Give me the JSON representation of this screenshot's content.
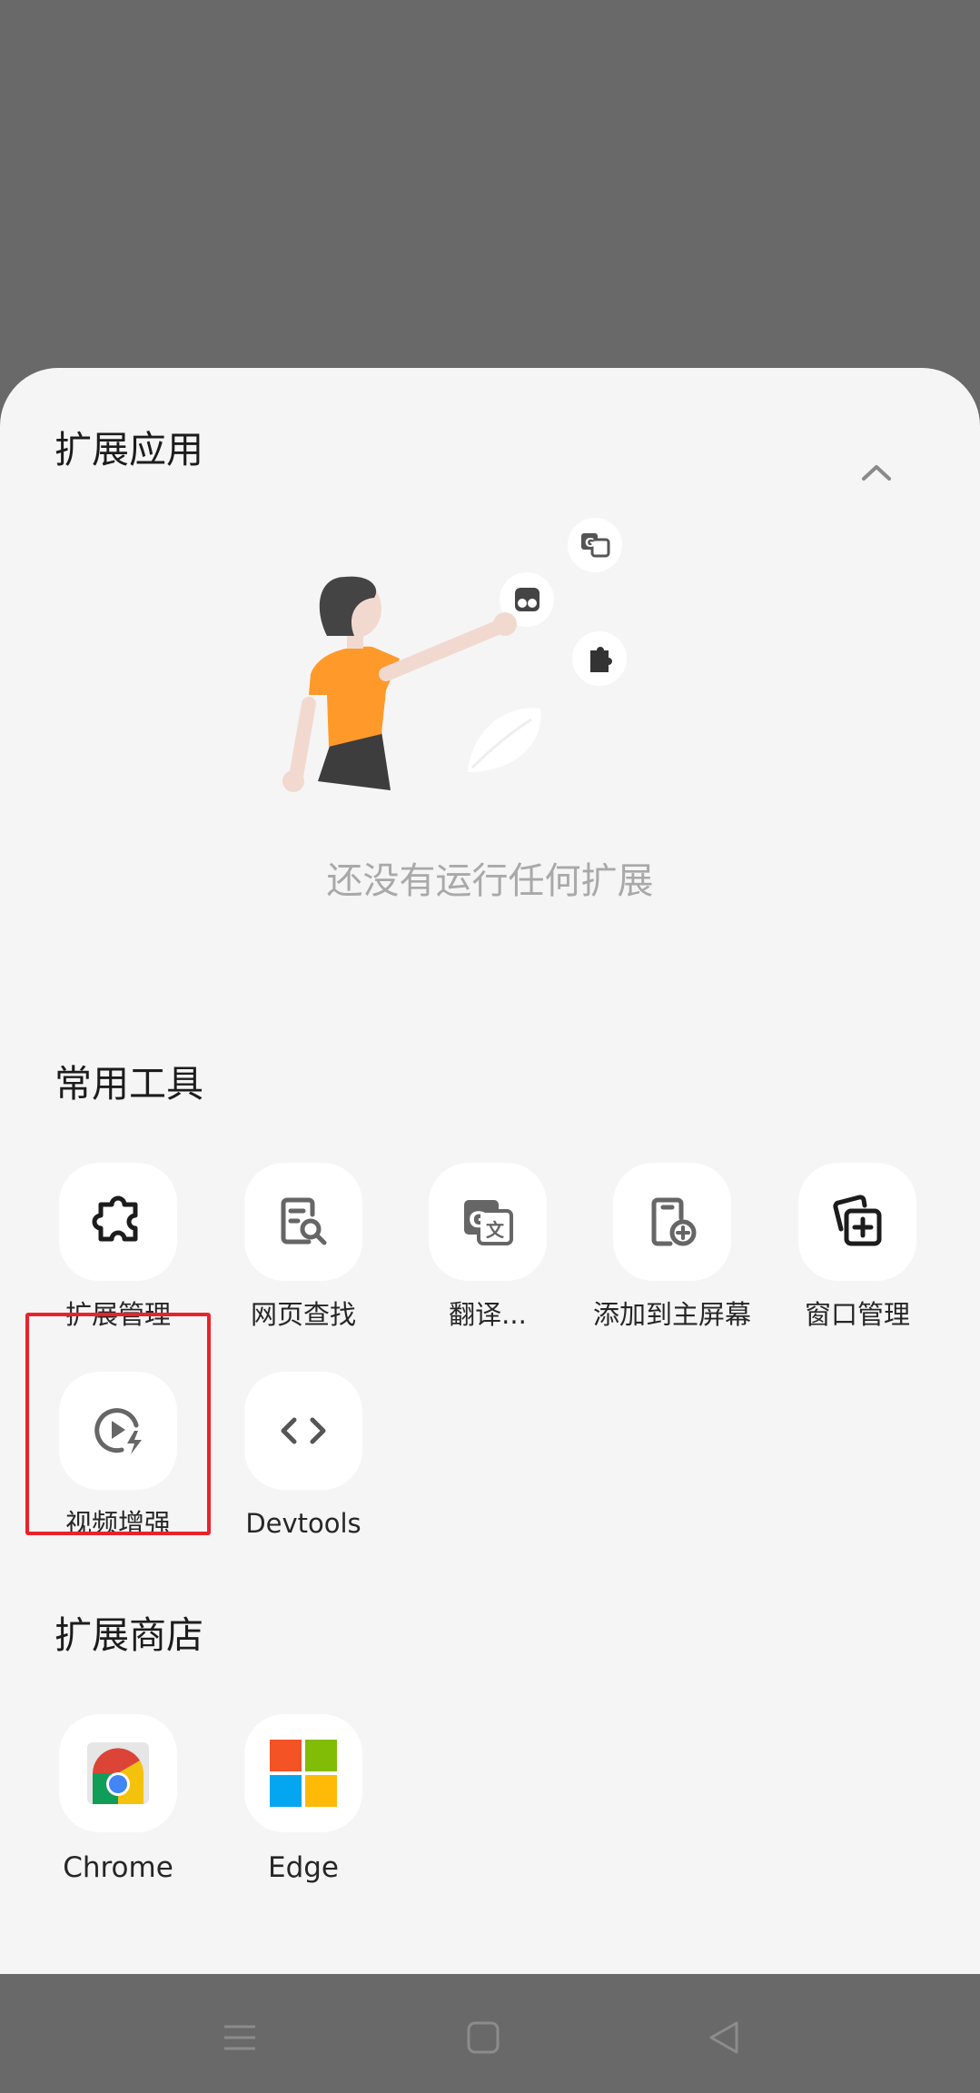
{
  "extensions": {
    "title": "扩展应用",
    "empty_text": "还没有运行任何扩展"
  },
  "common_tools": {
    "title": "常用工具",
    "items": [
      {
        "label": "扩展管理",
        "icon": "puzzle-icon"
      },
      {
        "label": "网页查找",
        "icon": "page-search-icon"
      },
      {
        "label": "翻译...",
        "icon": "translate-icon"
      },
      {
        "label": "添加到主屏幕",
        "icon": "add-to-home-icon"
      },
      {
        "label": "窗口管理",
        "icon": "window-add-icon"
      },
      {
        "label": "视频增强",
        "icon": "video-boost-icon"
      },
      {
        "label": "Devtools",
        "icon": "code-icon"
      }
    ]
  },
  "extension_store": {
    "title": "扩展商店",
    "items": [
      {
        "label": "Chrome",
        "icon": "chrome-store-icon"
      },
      {
        "label": "Edge",
        "icon": "microsoft-logo-icon"
      }
    ]
  },
  "colors": {
    "overlay": "#696969",
    "sheet": "#f5f5f5",
    "highlight": "#e8232b",
    "accent_orange": "#ff9a2a"
  },
  "navbar": {
    "icons": [
      "menu-icon",
      "home-icon",
      "back-icon"
    ]
  }
}
